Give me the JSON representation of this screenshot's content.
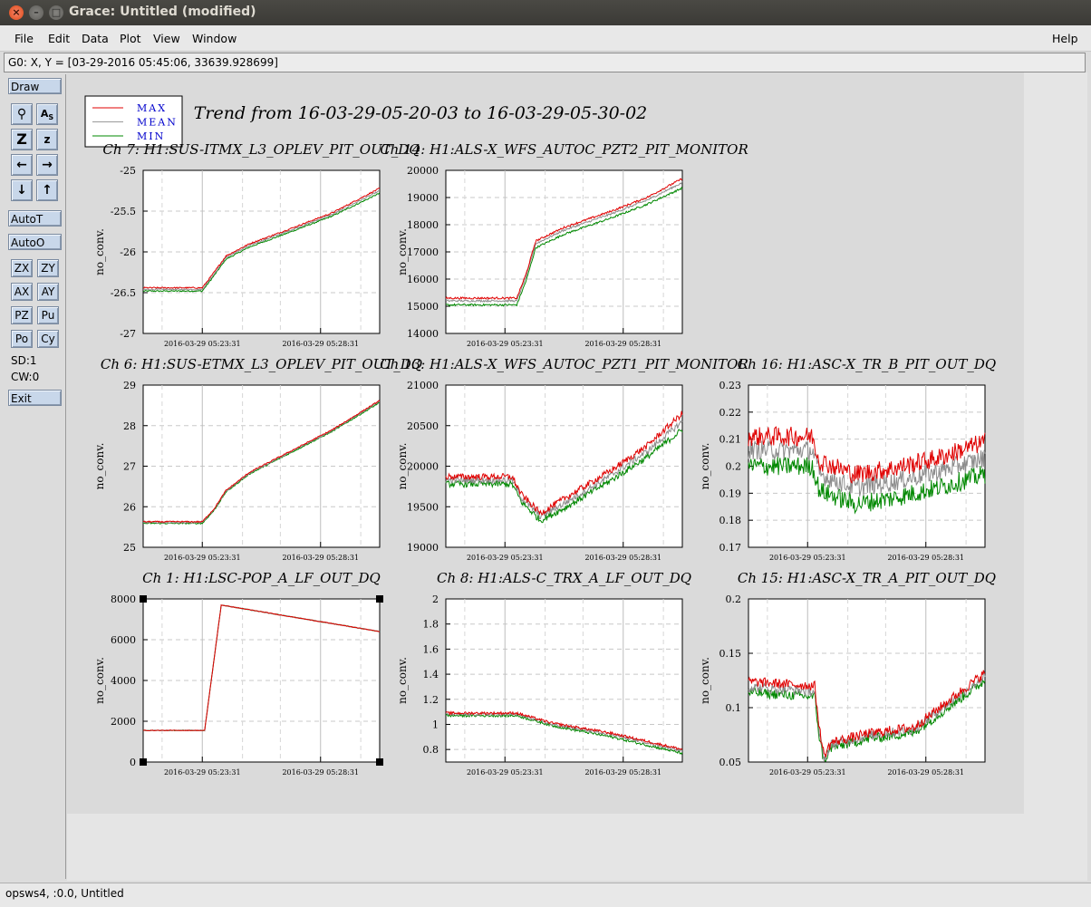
{
  "window": {
    "title": "Grace: Untitled (modified)"
  },
  "menu": {
    "file": "File",
    "edit": "Edit",
    "data": "Data",
    "plot": "Plot",
    "view": "View",
    "window": "Window",
    "help": "Help"
  },
  "locator": "G0: X, Y = [03-29-2016 05:45:06, 33639.928699]",
  "toolbar": {
    "draw": "Draw",
    "autot": "AutoT",
    "autoo": "AutoO",
    "zx": "ZX",
    "zy": "ZY",
    "ax": "AX",
    "ay": "AY",
    "pz": "PZ",
    "pu": "Pu",
    "po": "Po",
    "cy": "Cy",
    "sd": "SD:1",
    "cw": "CW:0",
    "exit": "Exit",
    "icons": [
      "zoom-icon",
      "autoscale-text-icon",
      "zoom-in-icon",
      "zoom-out-icon",
      "scroll-left-icon",
      "scroll-right-icon",
      "scroll-down-icon",
      "scroll-up-icon"
    ]
  },
  "plot": {
    "title": "Trend from 16-03-29-05-20-03 to 16-03-29-05-30-02",
    "legend": [
      {
        "name": "MAX",
        "color": "#e00000"
      },
      {
        "name": "MEAN",
        "color": "#9a9a9a"
      },
      {
        "name": "MIN",
        "color": "#008800"
      }
    ],
    "xtick_labels": [
      "2016-03-29 05:23:31",
      "2016-03-29 05:28:31"
    ],
    "ylabel": "no_conv."
  },
  "chart_data": [
    {
      "type": "line",
      "title": "Ch 7: H1:SUS-ITMX_L3_OPLEV_PIT_OUT_DQ",
      "ylabel": "no_conv.",
      "ylim": [
        -27,
        -25
      ],
      "yticks": [
        -25,
        -25.5,
        -26,
        -26.5,
        -27
      ],
      "x": [
        0,
        0.25,
        0.3,
        0.35,
        0.45,
        0.6,
        0.8,
        1
      ],
      "series": [
        {
          "name": "MAX",
          "values": [
            -26.44,
            -26.44,
            -26.25,
            -26.05,
            -25.9,
            -25.74,
            -25.52,
            -25.22
          ]
        },
        {
          "name": "MEAN",
          "values": [
            -26.46,
            -26.46,
            -26.27,
            -26.07,
            -25.92,
            -25.76,
            -25.54,
            -25.25
          ]
        },
        {
          "name": "MIN",
          "values": [
            -26.48,
            -26.48,
            -26.29,
            -26.09,
            -25.94,
            -25.78,
            -25.56,
            -25.28
          ]
        }
      ]
    },
    {
      "type": "line",
      "title": "Ch 14: H1:ALS-X_WFS_AUTOC_PZT2_PIT_MONITOR",
      "ylabel": "no_conv.",
      "ylim": [
        14000,
        20000
      ],
      "yticks": [
        20000,
        19000,
        18000,
        17000,
        16000,
        15000,
        14000
      ],
      "x": [
        0,
        0.3,
        0.34,
        0.38,
        0.5,
        0.7,
        0.85,
        1
      ],
      "series": [
        {
          "name": "MAX",
          "values": [
            15300,
            15300,
            16200,
            17400,
            17900,
            18500,
            19000,
            19700
          ]
        },
        {
          "name": "MEAN",
          "values": [
            15200,
            15200,
            16100,
            17300,
            17800,
            18400,
            18900,
            19550
          ]
        },
        {
          "name": "MIN",
          "values": [
            15050,
            15050,
            15950,
            17150,
            17650,
            18250,
            18750,
            19350
          ]
        }
      ]
    },
    {
      "type": "line",
      "title": "Ch 6: H1:SUS-ETMX_L3_OPLEV_PIT_OUT_DQ",
      "ylabel": "no_conv.",
      "ylim": [
        25,
        29
      ],
      "yticks": [
        29,
        28,
        27,
        26,
        25
      ],
      "x": [
        0,
        0.25,
        0.3,
        0.35,
        0.45,
        0.6,
        0.8,
        1
      ],
      "series": [
        {
          "name": "MAX",
          "values": [
            25.63,
            25.63,
            25.95,
            26.4,
            26.85,
            27.3,
            27.9,
            28.62
          ]
        },
        {
          "name": "MEAN",
          "values": [
            25.61,
            25.61,
            25.93,
            26.38,
            26.83,
            27.28,
            27.88,
            28.6
          ]
        },
        {
          "name": "MIN",
          "values": [
            25.59,
            25.59,
            25.91,
            26.36,
            26.81,
            27.26,
            27.86,
            28.57
          ]
        }
      ]
    },
    {
      "type": "line",
      "title": "Ch 13: H1:ALS-X_WFS_AUTOC_PZT1_PIT_MONITOR",
      "ylabel": "no_conv.",
      "ylim": [
        19000,
        21000
      ],
      "yticks": [
        21000,
        20500,
        20000,
        19500,
        19000
      ],
      "x": [
        0,
        0.28,
        0.32,
        0.4,
        0.5,
        0.7,
        0.85,
        1
      ],
      "series": [
        {
          "name": "MAX",
          "values": [
            19870,
            19870,
            19650,
            19420,
            19600,
            19950,
            20250,
            20650
          ]
        },
        {
          "name": "MEAN",
          "values": [
            19830,
            19830,
            19610,
            19380,
            19540,
            19890,
            20180,
            20550
          ]
        },
        {
          "name": "MIN",
          "values": [
            19780,
            19780,
            19560,
            19330,
            19480,
            19830,
            20110,
            20450
          ]
        }
      ]
    },
    {
      "type": "line",
      "title": "Ch 16: H1:ASC-X_TR_B_PIT_OUT_DQ",
      "ylabel": "no_conv.",
      "ylim": [
        0.17,
        0.23
      ],
      "yticks": [
        0.23,
        0.22,
        0.21,
        0.2,
        0.19,
        0.18,
        0.17
      ],
      "x": [
        0,
        0.27,
        0.3,
        0.45,
        0.6,
        0.8,
        1
      ],
      "series": [
        {
          "name": "MAX",
          "values": [
            0.211,
            0.211,
            0.202,
            0.197,
            0.199,
            0.203,
            0.209
          ]
        },
        {
          "name": "MEAN",
          "values": [
            0.206,
            0.206,
            0.197,
            0.192,
            0.194,
            0.198,
            0.203
          ]
        },
        {
          "name": "MIN",
          "values": [
            0.2,
            0.2,
            0.191,
            0.186,
            0.188,
            0.192,
            0.197
          ]
        }
      ]
    },
    {
      "type": "line",
      "title": "Ch 1: H1:LSC-POP_A_LF_OUT_DQ",
      "ylabel": "no_conv.",
      "ylim": [
        0,
        8000
      ],
      "yticks": [
        8000,
        6000,
        4000,
        2000,
        0
      ],
      "x": [
        0,
        0.26,
        0.33,
        1
      ],
      "series": [
        {
          "name": "MAX",
          "values": [
            1550,
            1550,
            7700,
            6400
          ]
        },
        {
          "name": "MEAN",
          "values": [
            1550,
            1550,
            7700,
            6400
          ]
        },
        {
          "name": "MIN",
          "values": [
            1550,
            1550,
            7700,
            6400
          ]
        }
      ]
    },
    {
      "type": "line",
      "title": "Ch 8: H1:ALS-C_TRX_A_LF_OUT_DQ",
      "ylabel": "no_conv.",
      "ylim": [
        0.7,
        2
      ],
      "yticks": [
        2,
        1.8,
        1.6,
        1.4,
        1.2,
        1,
        0.8
      ],
      "x": [
        0,
        0.3,
        0.45,
        0.7,
        1
      ],
      "series": [
        {
          "name": "MAX",
          "values": [
            1.09,
            1.09,
            1.01,
            0.93,
            0.8
          ]
        },
        {
          "name": "MEAN",
          "values": [
            1.08,
            1.08,
            1.0,
            0.92,
            0.79
          ]
        },
        {
          "name": "MIN",
          "values": [
            1.07,
            1.07,
            0.99,
            0.9,
            0.77
          ]
        }
      ]
    },
    {
      "type": "line",
      "title": "Ch 15: H1:ASC-X_TR_A_PIT_OUT_DQ",
      "ylabel": "no_conv.",
      "ylim": [
        0.05,
        0.2
      ],
      "yticks": [
        0.2,
        0.15,
        0.1,
        0.05
      ],
      "x": [
        0,
        0.28,
        0.3,
        0.32,
        0.35,
        0.5,
        0.7,
        1
      ],
      "series": [
        {
          "name": "MAX",
          "values": [
            0.124,
            0.12,
            0.08,
            0.056,
            0.068,
            0.076,
            0.082,
            0.132
          ]
        },
        {
          "name": "MEAN",
          "values": [
            0.119,
            0.115,
            0.076,
            0.053,
            0.066,
            0.074,
            0.08,
            0.129
          ]
        },
        {
          "name": "MIN",
          "values": [
            0.114,
            0.11,
            0.072,
            0.05,
            0.063,
            0.071,
            0.077,
            0.125
          ]
        }
      ]
    }
  ],
  "status": "opsws4, :0.0, Untitled"
}
